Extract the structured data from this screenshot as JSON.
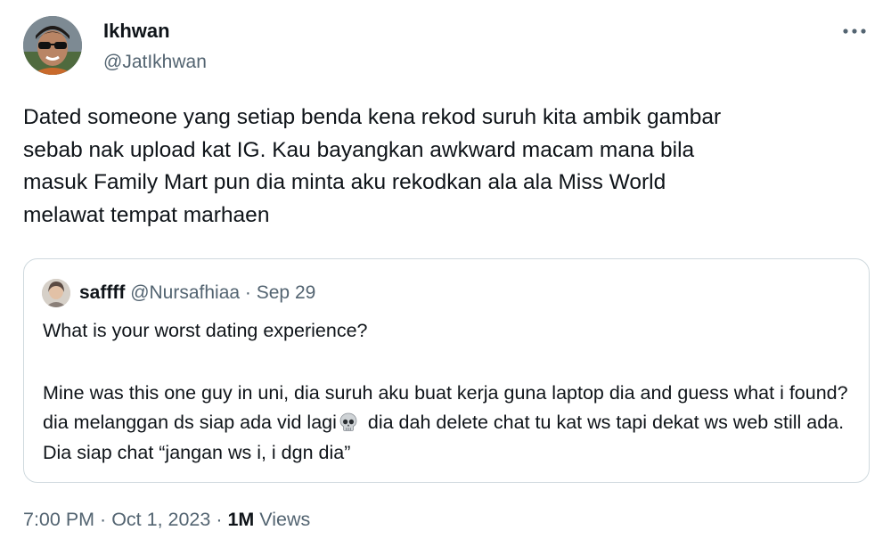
{
  "author": {
    "name": "Ikhwan",
    "handle": "@JatIkhwan",
    "avatar_icon": "profile-photo-man-sunglasses"
  },
  "more_icon": "more-horizontal-icon",
  "tweet": {
    "text": "Dated someone yang setiap benda kena rekod suruh kita ambik gambar\nsebab nak upload kat IG. Kau bayangkan awkward macam mana bila\nmasuk Family Mart pun dia minta aku rekodkan ala ala Miss World\nmelawat tempat marhaen"
  },
  "quoted_tweet": {
    "author_name": "saffff",
    "handle": "@Nursafhiaa",
    "separator": "·",
    "date": "Sep 29",
    "avatar_icon": "profile-photo-woman",
    "paragraph1": "What is your worst dating experience?",
    "paragraph2_part1": "Mine was this one guy in uni, dia suruh aku buat kerja guna laptop dia and guess what i found? dia melanggan ds siap ada vid lagi",
    "emoji_icon": "skull-icon",
    "paragraph2_part2": " dia dah delete chat tu kat ws tapi dekat ws web still ada. Dia siap chat “jangan ws i, i dgn dia”"
  },
  "meta": {
    "time": "7:00 PM",
    "separator1": " · ",
    "date": "Oct 1, 2023",
    "separator2": " · ",
    "views_count": "1M",
    "views_label": " Views"
  },
  "colors": {
    "primary_text": "#0f1419",
    "secondary_text": "#536471",
    "border": "#cfd9de"
  }
}
